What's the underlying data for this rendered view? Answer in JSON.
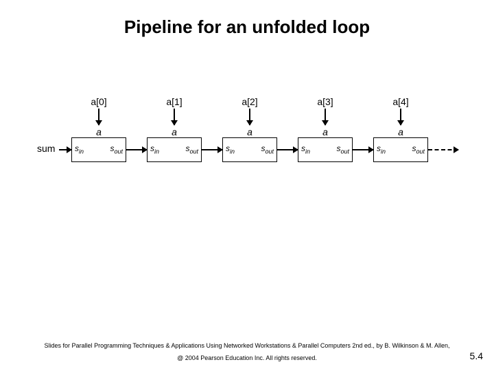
{
  "title": "Pipeline for an unfolded loop",
  "sum_label": "sum",
  "stages": [
    {
      "input": "a[0]",
      "a": "a",
      "sin": "s",
      "sin_sub": "in",
      "sout": "s",
      "sout_sub": "out"
    },
    {
      "input": "a[1]",
      "a": "a",
      "sin": "s",
      "sin_sub": "in",
      "sout": "s",
      "sout_sub": "out"
    },
    {
      "input": "a[2]",
      "a": "a",
      "sin": "s",
      "sin_sub": "in",
      "sout": "s",
      "sout_sub": "out"
    },
    {
      "input": "a[3]",
      "a": "a",
      "sin": "s",
      "sin_sub": "in",
      "sout": "s",
      "sout_sub": "out"
    },
    {
      "input": "a[4]",
      "a": "a",
      "sin": "s",
      "sin_sub": "in",
      "sout": "s",
      "sout_sub": "out"
    }
  ],
  "footer_line1": "Slides for Parallel Programming Techniques & Applications Using Networked Workstations & Parallel Computers 2nd ed., by B. Wilkinson & M. Allen,",
  "footer_line2": "@ 2004 Pearson Education Inc. All rights reserved.",
  "page_number": "5.4"
}
